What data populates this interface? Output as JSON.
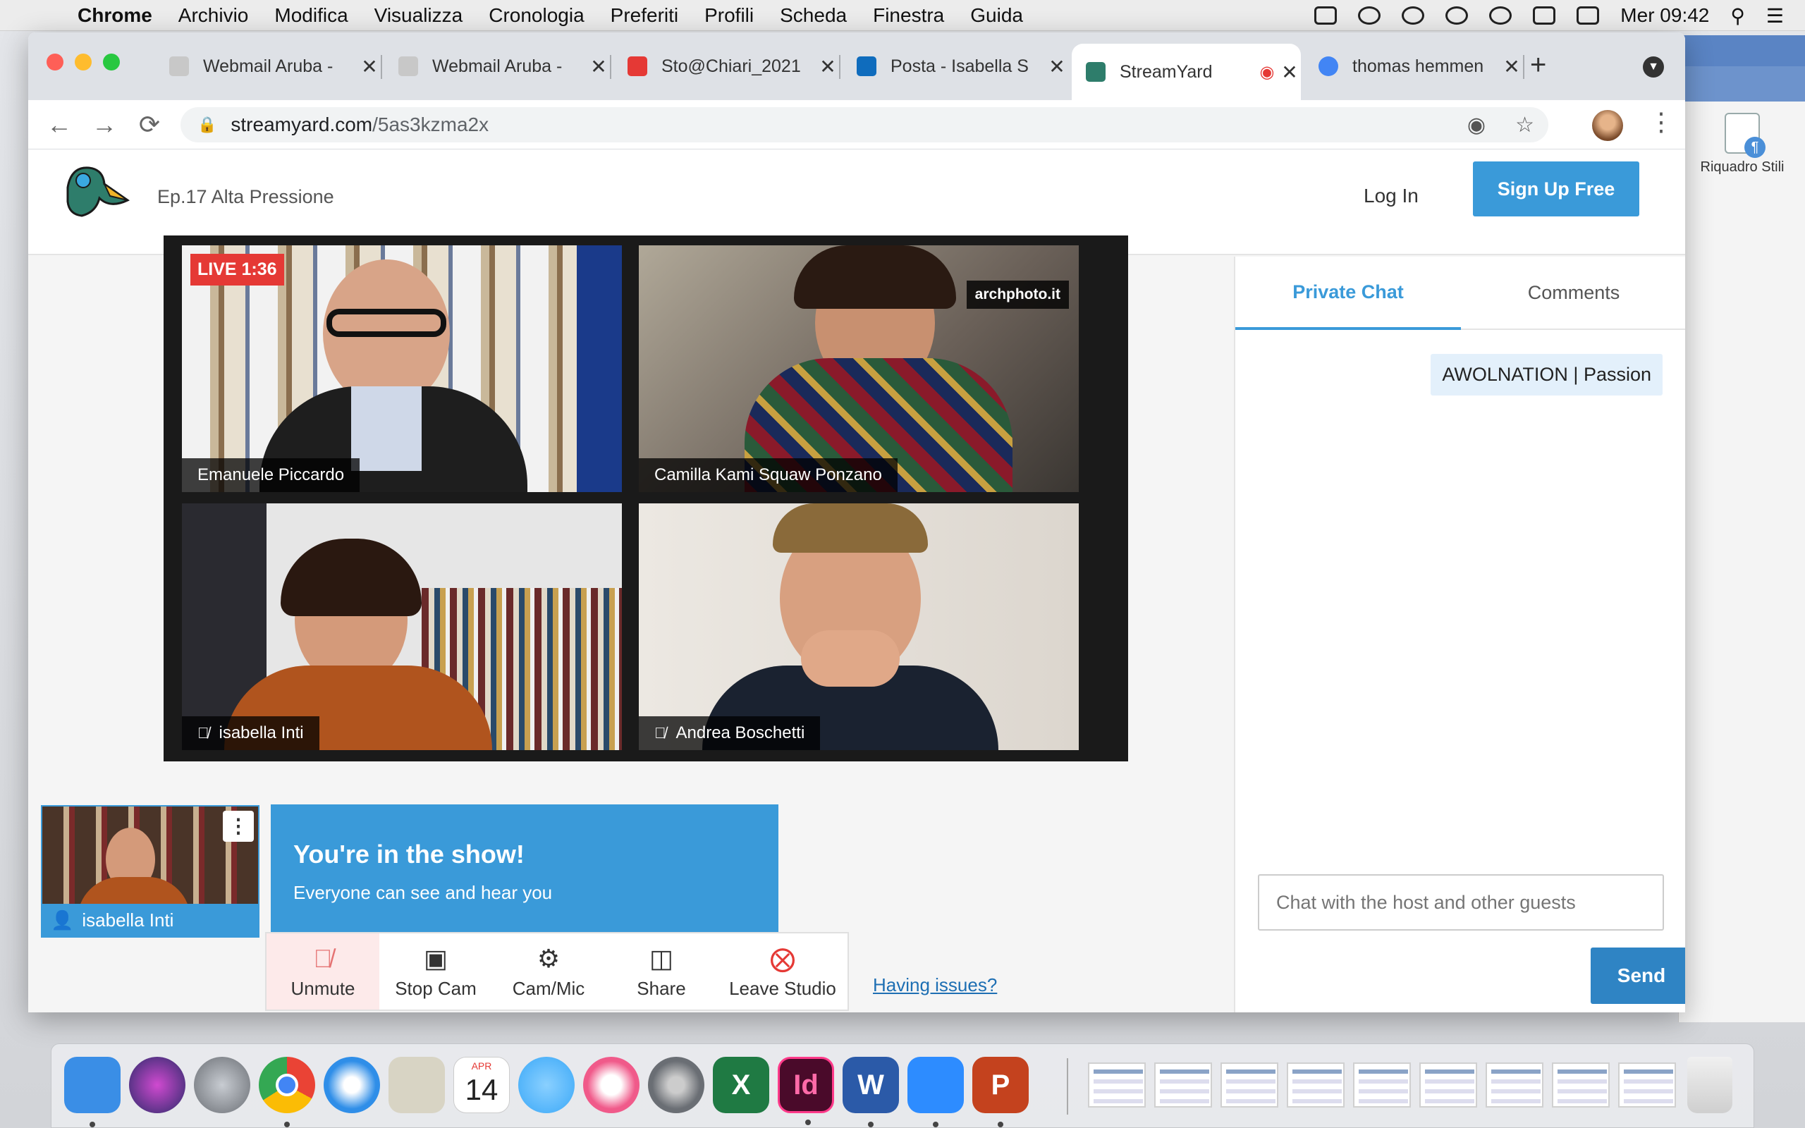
{
  "menubar": {
    "app": "Chrome",
    "items": [
      "Archivio",
      "Modifica",
      "Visualizza",
      "Cronologia",
      "Preferiti",
      "Profili",
      "Scheda",
      "Finestra",
      "Guida"
    ],
    "clock": "Mer 09:42"
  },
  "background_app": {
    "tool_label": "Riquadro Stili"
  },
  "tabs": [
    {
      "title": "Webmail Aruba -",
      "color": "#c8c8c8"
    },
    {
      "title": "Webmail Aruba -",
      "color": "#c8c8c8"
    },
    {
      "title": "Sto@Chiari_2021",
      "color": "#e53935"
    },
    {
      "title": "Posta - Isabella S",
      "color": "#0f6cbd"
    },
    {
      "title": "StreamYard",
      "color": "#2e7d6b"
    },
    {
      "title": "thomas hemmen",
      "color": "#4285f4"
    }
  ],
  "address": {
    "domain": "streamyard.com",
    "path": "/5as3kzma2x"
  },
  "header": {
    "episode": "Ep.17 Alta Pressione",
    "login": "Log In",
    "signup": "Sign Up Free"
  },
  "stage": {
    "live": "LIVE 1:36",
    "watermark": "archphoto.it",
    "participants": [
      {
        "name": "Emanuele Piccardo",
        "muted": false
      },
      {
        "name": "Camilla Kami Squaw Ponzano",
        "muted": false
      },
      {
        "name": "isabella Inti",
        "muted": true
      },
      {
        "name": "Andrea Boschetti",
        "muted": true
      }
    ]
  },
  "self": {
    "name": "isabella Inti"
  },
  "banner": {
    "title": "You're in the show!",
    "subtitle": "Everyone can see and hear you"
  },
  "controls": {
    "unmute": "Unmute",
    "stop_cam": "Stop Cam",
    "cam_mic": "Cam/Mic",
    "share": "Share",
    "leave": "Leave Studio",
    "issues": "Having issues?"
  },
  "chat": {
    "tab_private": "Private Chat",
    "tab_comments": "Comments",
    "message": "AWOLNATION | Passion",
    "placeholder": "Chat with the host and other guests",
    "send": "Send"
  },
  "dock": {
    "calendar_month": "APR",
    "calendar_day": "14",
    "apps": [
      {
        "name": "finder-icon",
        "color": "#3a8ee6",
        "label": ""
      },
      {
        "name": "siri-icon",
        "color": "#2a2a6a",
        "label": ""
      },
      {
        "name": "launchpad-icon",
        "color": "#9aa0a8",
        "label": ""
      },
      {
        "name": "chrome-icon",
        "color": "#e8e8e8",
        "label": ""
      },
      {
        "name": "safari-icon",
        "color": "#2f8ee8",
        "label": ""
      },
      {
        "name": "preview-icon",
        "color": "#d8d4c4",
        "label": ""
      },
      {
        "name": "calendar-icon",
        "color": "#ffffff",
        "label": ""
      },
      {
        "name": "messages-icon",
        "color": "#3aa8f8",
        "label": ""
      },
      {
        "name": "music-icon",
        "color": "#f05a8a",
        "label": ""
      },
      {
        "name": "system-preferences-icon",
        "color": "#6a6e74",
        "label": ""
      },
      {
        "name": "excel-icon",
        "color": "#1f7a43",
        "label": "X"
      },
      {
        "name": "indesign-icon",
        "color": "#4a0a2a",
        "label": "Id"
      },
      {
        "name": "word-icon",
        "color": "#2b5aa8",
        "label": "W"
      },
      {
        "name": "zoom-icon",
        "color": "#2d8cff",
        "label": ""
      },
      {
        "name": "powerpoint-icon",
        "color": "#c4421e",
        "label": "P"
      }
    ]
  }
}
